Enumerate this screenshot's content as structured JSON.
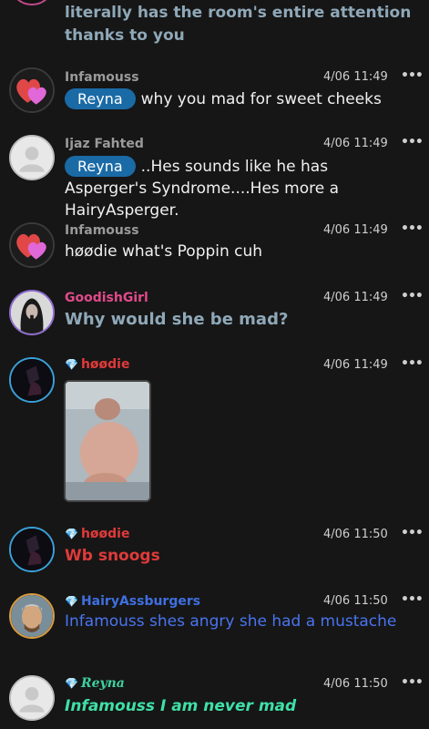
{
  "messages": [
    {
      "text": "literally has the room's entire attention thanks to you",
      "text_color": "#8fa8b8"
    },
    {
      "username": "Infamouss",
      "time": "4/06 11:49",
      "mention": "Reyna",
      "text": "why you mad for sweet cheeks",
      "avatar": "heart-avatar"
    },
    {
      "username": "Ijaz Fahted",
      "time": "4/06 11:49",
      "mention": "Reyna",
      "text": "..Hes sounds like he has Asperger's Syndrome....Hes more a HairyAsperger.",
      "avatar": "default-user-avatar"
    },
    {
      "username": "Infamouss",
      "time": "4/06 11:49",
      "text": "høødie what's Poppin cuh",
      "avatar": "heart-avatar"
    },
    {
      "username": "GoodishGirl",
      "username_color": "#e04a8a",
      "time": "4/06 11:49",
      "text": "Why would she be mad?",
      "text_color": "#8fa8b8",
      "avatar": "portrait-avatar"
    },
    {
      "username": "høødie",
      "username_color": "#e03a3a",
      "time": "4/06 11:49",
      "badge": "diamond-icon",
      "avatar": "dark-avatar",
      "image": "photo-attachment"
    },
    {
      "username": "høødie",
      "username_color": "#e03a3a",
      "time": "4/06 11:50",
      "text": "Wb snoogs",
      "text_color": "#e03a3a",
      "badge": "diamond-icon",
      "avatar": "dark-avatar"
    },
    {
      "username": "HairyAssburgers",
      "username_color": "#3f6fe0",
      "time": "4/06 11:50",
      "text": "Infamouss shes angry she had a mustache",
      "text_color": "#4a74f0",
      "badge": "diamond-icon",
      "avatar": "selfie-avatar"
    },
    {
      "username": "Reyna",
      "username_color": "#3fd0a0",
      "time": "4/06 11:50",
      "text": "Infamouss I am never mad",
      "text_color": "#3fe0a8",
      "badge": "diamond-icon",
      "avatar": "default-user-avatar"
    }
  ],
  "more_label": "•••"
}
